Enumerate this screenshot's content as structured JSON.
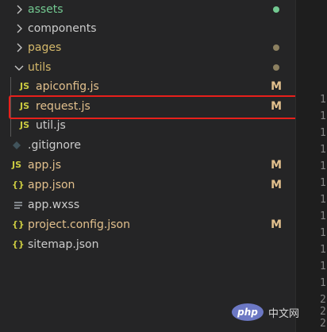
{
  "colors": {
    "folder_label": "#d4b86a",
    "modified": "#e2c08d",
    "untracked_dot": "#73c991",
    "js_icon": "#cbcb41",
    "json_icon": "#cbcb41",
    "highlight_border": "#e8201b"
  },
  "explorer": {
    "items": [
      {
        "label": "assets",
        "kind": "folder",
        "expanded": false,
        "status": "dot",
        "icon": "chevron-right-icon"
      },
      {
        "label": "components",
        "kind": "folder",
        "expanded": false,
        "status": "",
        "icon": "chevron-right-icon"
      },
      {
        "label": "pages",
        "kind": "folder",
        "expanded": false,
        "status": "dot",
        "icon": "chevron-right-icon"
      },
      {
        "label": "utils",
        "kind": "folder",
        "expanded": true,
        "status": "dot",
        "icon": "chevron-down-icon"
      },
      {
        "label": "apiconfig.js",
        "kind": "js",
        "icon_text": "JS",
        "status": "M"
      },
      {
        "label": "request.js",
        "kind": "js",
        "icon_text": "JS",
        "status": "M",
        "highlighted": true
      },
      {
        "label": "util.js",
        "kind": "js",
        "icon_text": "JS",
        "status": ""
      },
      {
        "label": ".gitignore",
        "kind": "gitignore",
        "status": ""
      },
      {
        "label": "app.js",
        "kind": "js",
        "icon_text": "JS",
        "status": "M"
      },
      {
        "label": "app.json",
        "kind": "json",
        "icon_text": "{}",
        "status": "M"
      },
      {
        "label": "app.wxss",
        "kind": "wxss",
        "status": ""
      },
      {
        "label": "project.config.json",
        "kind": "json",
        "icon_text": "{}",
        "status": "M"
      },
      {
        "label": "sitemap.json",
        "kind": "json",
        "icon_text": "{}",
        "status": ""
      }
    ]
  },
  "editor": {
    "line_numbers": [
      "1",
      "1",
      "1",
      "1",
      "1",
      "1",
      "1",
      "1",
      "1",
      "1",
      "1",
      "1",
      "2",
      "2",
      "2"
    ]
  },
  "watermark": {
    "logo_text": "php",
    "site_text": "中文网"
  }
}
